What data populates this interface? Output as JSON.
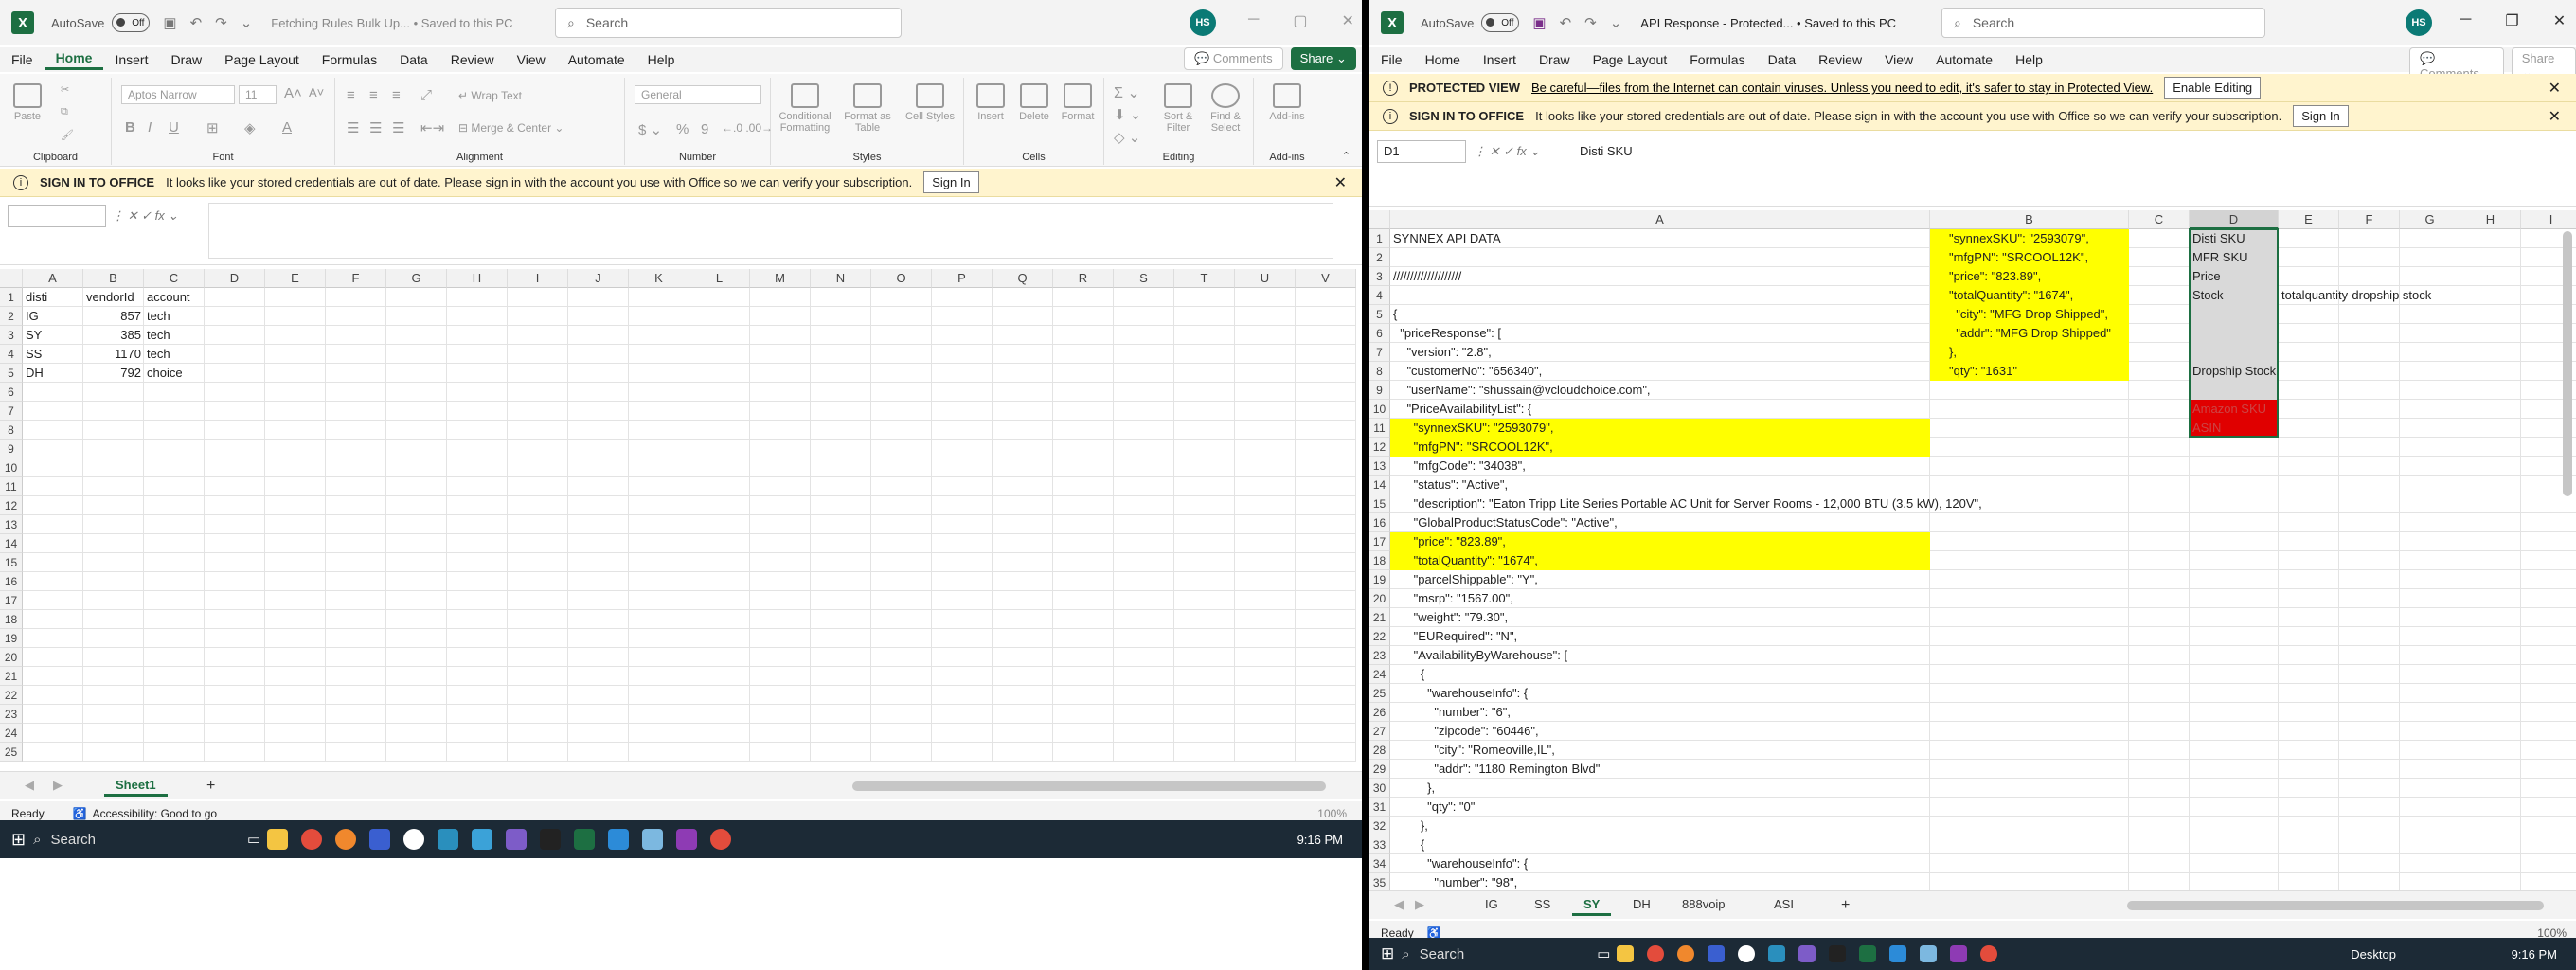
{
  "left": {
    "autosave": "AutoSave",
    "autosave_state": "Off",
    "doc_title": "Fetching Rules Bulk Up... • Saved to this PC",
    "search_placeholder": "Search",
    "avatar": "HS",
    "menu": [
      "File",
      "Home",
      "Insert",
      "Draw",
      "Page Layout",
      "Formulas",
      "Data",
      "Review",
      "View",
      "Automate",
      "Help"
    ],
    "comments": "Comments",
    "share": "Share",
    "ribbon": {
      "paste": "Paste",
      "font_name": "Aptos Narrow",
      "font_size": "11",
      "wrap": "Wrap Text",
      "merge": "Merge & Center",
      "number_format": "General",
      "conditional": "Conditional Formatting",
      "format_table": "Format as Table",
      "cell_styles": "Cell Styles",
      "insert": "Insert",
      "delete": "Delete",
      "format": "Format",
      "sort": "Sort & Filter",
      "find": "Find & Select",
      "addins": "Add-ins",
      "groups": [
        "Clipboard",
        "Font",
        "Alignment",
        "Number",
        "Styles",
        "Cells",
        "Editing",
        "Add-ins"
      ]
    },
    "signin_banner": {
      "title": "SIGN IN TO OFFICE",
      "text": "It looks like your stored credentials are out of date. Please sign in with the account you use with Office so we can verify your subscription.",
      "button": "Sign In"
    },
    "name_box": "",
    "formula": "",
    "columns": [
      "A",
      "B",
      "C",
      "D",
      "E",
      "F",
      "G",
      "H",
      "I",
      "J",
      "K",
      "L",
      "M",
      "N",
      "O",
      "P",
      "Q",
      "R",
      "S",
      "T",
      "U",
      "V"
    ],
    "rows": [
      "1",
      "2",
      "3",
      "4",
      "5",
      "6",
      "7",
      "8",
      "9",
      "10",
      "11",
      "12",
      "13",
      "14",
      "15",
      "16",
      "17",
      "18",
      "19",
      "20",
      "21",
      "22",
      "23",
      "24",
      "25"
    ],
    "cells": [
      [
        "disti",
        "vendorId",
        "account"
      ],
      [
        "IG",
        "857",
        "tech"
      ],
      [
        "SY",
        "385",
        "tech"
      ],
      [
        "SS",
        "1170",
        "tech"
      ],
      [
        "DH",
        "792",
        "choice"
      ]
    ],
    "sheet_tab": "Sheet1",
    "status": "Ready",
    "accessibility": "Accessibility: Good to go",
    "zoom": "100%"
  },
  "right": {
    "autosave": "AutoSave",
    "autosave_state": "Off",
    "doc_title": "API Response - Protected... • Saved to this PC",
    "search_placeholder": "Search",
    "avatar": "HS",
    "menu": [
      "File",
      "Home",
      "Insert",
      "Draw",
      "Page Layout",
      "Formulas",
      "Data",
      "Review",
      "View",
      "Automate",
      "Help"
    ],
    "comments": "Comments",
    "share": "Share",
    "protected_banner": {
      "title": "PROTECTED VIEW",
      "text": "Be careful—files from the Internet can contain viruses. Unless you need to edit, it's safer to stay in Protected View.",
      "button": "Enable Editing"
    },
    "signin_banner": {
      "title": "SIGN IN TO OFFICE",
      "text": "It looks like your stored credentials are out of date. Please sign in with the account you use with Office so we can verify your subscription.",
      "button": "Sign In"
    },
    "name_box": "D1",
    "formula": "Disti SKU",
    "columns": [
      "A",
      "B",
      "C",
      "D",
      "E",
      "F",
      "G",
      "H",
      "I"
    ],
    "colA": [
      "SYNNEX API DATA",
      "",
      "////////////////////",
      "",
      "{",
      "  \"priceResponse\": [",
      "    \"version\": \"2.8\",",
      "    \"customerNo\": \"656340\",",
      "    \"userName\": \"shussain@vcloudchoice.com\",",
      "    \"PriceAvailabilityList\": {",
      "      \"synnexSKU\": \"2593079\",",
      "      \"mfgPN\": \"SRCOOL12K\",",
      "      \"mfgCode\": \"34038\",",
      "      \"status\": \"Active\",",
      "      \"description\": \"Eaton Tripp Lite Series Portable AC Unit for Server Rooms - 12,000 BTU (3.5 kW), 120V\",",
      "      \"GlobalProductStatusCode\": \"Active\",",
      "      \"price\": \"823.89\",",
      "      \"totalQuantity\": \"1674\",",
      "      \"parcelShippable\": \"Y\",",
      "      \"msrp\": \"1567.00\",",
      "      \"weight\": \"79.30\",",
      "      \"EURequired\": \"N\",",
      "      \"AvailabilityByWarehouse\": [",
      "        {",
      "          \"warehouseInfo\": {",
      "            \"number\": \"6\",",
      "            \"zipcode\": \"60446\",",
      "            \"city\": \"Romeoville,IL\",",
      "            \"addr\": \"1180 Remington Blvd\"",
      "          },",
      "          \"qty\": \"0\"",
      "        },",
      "        {",
      "          \"warehouseInfo\": {",
      "            \"number\": \"98\","
    ],
    "colB": [
      "\"synnexSKU\": \"2593079\",",
      "\"mfgPN\": \"SRCOOL12K\",",
      "\"price\": \"823.89\",",
      "\"totalQuantity\": \"1674\",",
      "  \"city\": \"MFG Drop Shipped\",",
      "  \"addr\": \"MFG Drop Shipped\"",
      "},",
      "\"qty\": \"1631\""
    ],
    "colD": [
      "Disti SKU",
      "MFR SKU",
      "Price",
      "Stock",
      "",
      "",
      "",
      "Dropship Stock",
      "",
      "Amazon SKU",
      "ASIN"
    ],
    "e4": "totalquantity-dropship stock",
    "sheet_tabs": [
      "IG",
      "SS",
      "SY",
      "DH",
      "888voip",
      "ASI"
    ],
    "active_tab": "SY",
    "status": "Ready",
    "zoom": "100%"
  },
  "taskbar": {
    "search": "Search",
    "time": "9:16 PM",
    "desktop": "Desktop"
  }
}
